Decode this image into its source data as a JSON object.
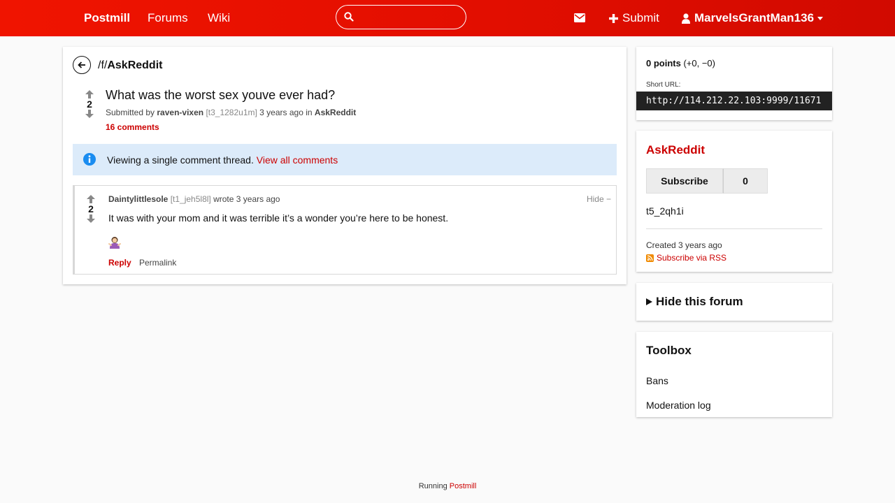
{
  "header": {
    "brand": "Postmill",
    "nav": [
      "Forums",
      "Wiki"
    ],
    "search_value": "",
    "submit_label": "Submit",
    "username": "MarvelsGrantMan136"
  },
  "breadcrumb": {
    "prefix": "/f/",
    "forum": "AskReddit"
  },
  "post": {
    "score": "2",
    "title": "What was the worst sex youve ever had?",
    "submitted_by_label": "Submitted by",
    "author": "raven-vixen",
    "id": "[t3_1282u1m]",
    "time_and_in": "3 years ago in",
    "forum": "AskReddit",
    "comments": "16 comments"
  },
  "notice": {
    "text": "Viewing a single comment thread.",
    "link": "View all comments"
  },
  "comment": {
    "score": "2",
    "author": "Daintylittlesole",
    "id": "[t1_jeh5l8l]",
    "wrote": "wrote 3 years ago",
    "hide": "Hide −",
    "body": "It was with your mom and it was terrible it’s a wonder you’re here to be honest.",
    "reply": "Reply",
    "permalink": "Permalink"
  },
  "sidebar": {
    "points_bold": "0 points",
    "points_detail": "(+0, −0)",
    "short_url_label": "Short URL:",
    "short_url": "http://114.212.22.103:9999/11671",
    "forum_title": "AskReddit",
    "subscribe": "Subscribe",
    "subscriber_count": "0",
    "forum_id": "t5_2qh1i",
    "created": "Created 3 years ago",
    "rss": "Subscribe via RSS",
    "hide_forum": "Hide this forum",
    "toolbox_title": "Toolbox",
    "toolbox_items": [
      "Bans",
      "Moderation log"
    ]
  },
  "footer": {
    "running": "Running",
    "link": "Postmill"
  },
  "colors": {
    "accent": "#cc0000",
    "header": "#e20e00",
    "notice_bg": "#dcebfa"
  }
}
